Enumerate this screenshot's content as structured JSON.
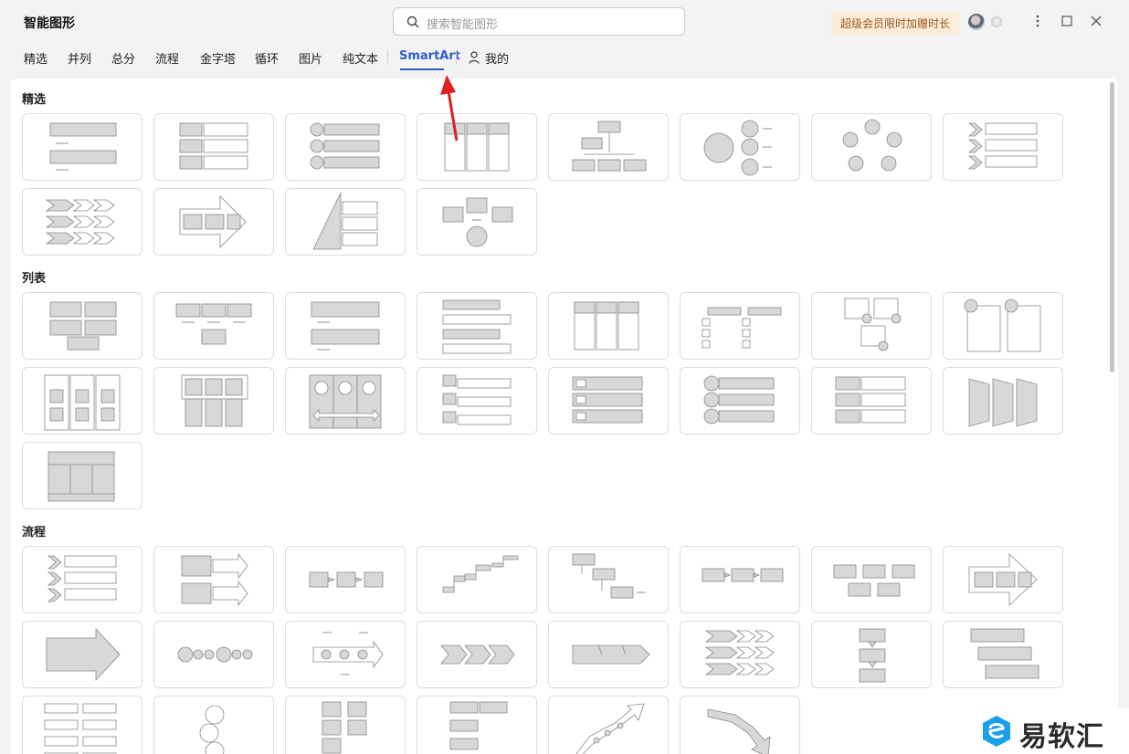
{
  "app": {
    "title": "智能图形"
  },
  "search": {
    "placeholder": "搜索智能图形"
  },
  "vip_banner": "超级会员限时加赠时长",
  "window_controls": [
    "more",
    "maximize",
    "close"
  ],
  "tabs": [
    {
      "label": "精选",
      "active": false
    },
    {
      "label": "并列",
      "active": false
    },
    {
      "label": "总分",
      "active": false
    },
    {
      "label": "流程",
      "active": false
    },
    {
      "label": "金字塔",
      "active": false
    },
    {
      "label": "循环",
      "active": false
    },
    {
      "label": "图片",
      "active": false
    },
    {
      "label": "纯文本",
      "active": false
    },
    {
      "label": "SmartArt",
      "active": true
    },
    {
      "label": "我的",
      "active": false,
      "icon": "person-icon"
    }
  ],
  "sections": [
    {
      "title": "精选",
      "card_count": 12
    },
    {
      "title": "列表",
      "card_count": 17
    },
    {
      "title": "流程",
      "card_count": 22
    }
  ],
  "watermark": {
    "text": "易软汇"
  },
  "colors": {
    "accent": "#2f5dc8",
    "vip_bg": "#fcebd9",
    "vip_text": "#9a5a1c",
    "annotation_arrow": "#e02020"
  }
}
